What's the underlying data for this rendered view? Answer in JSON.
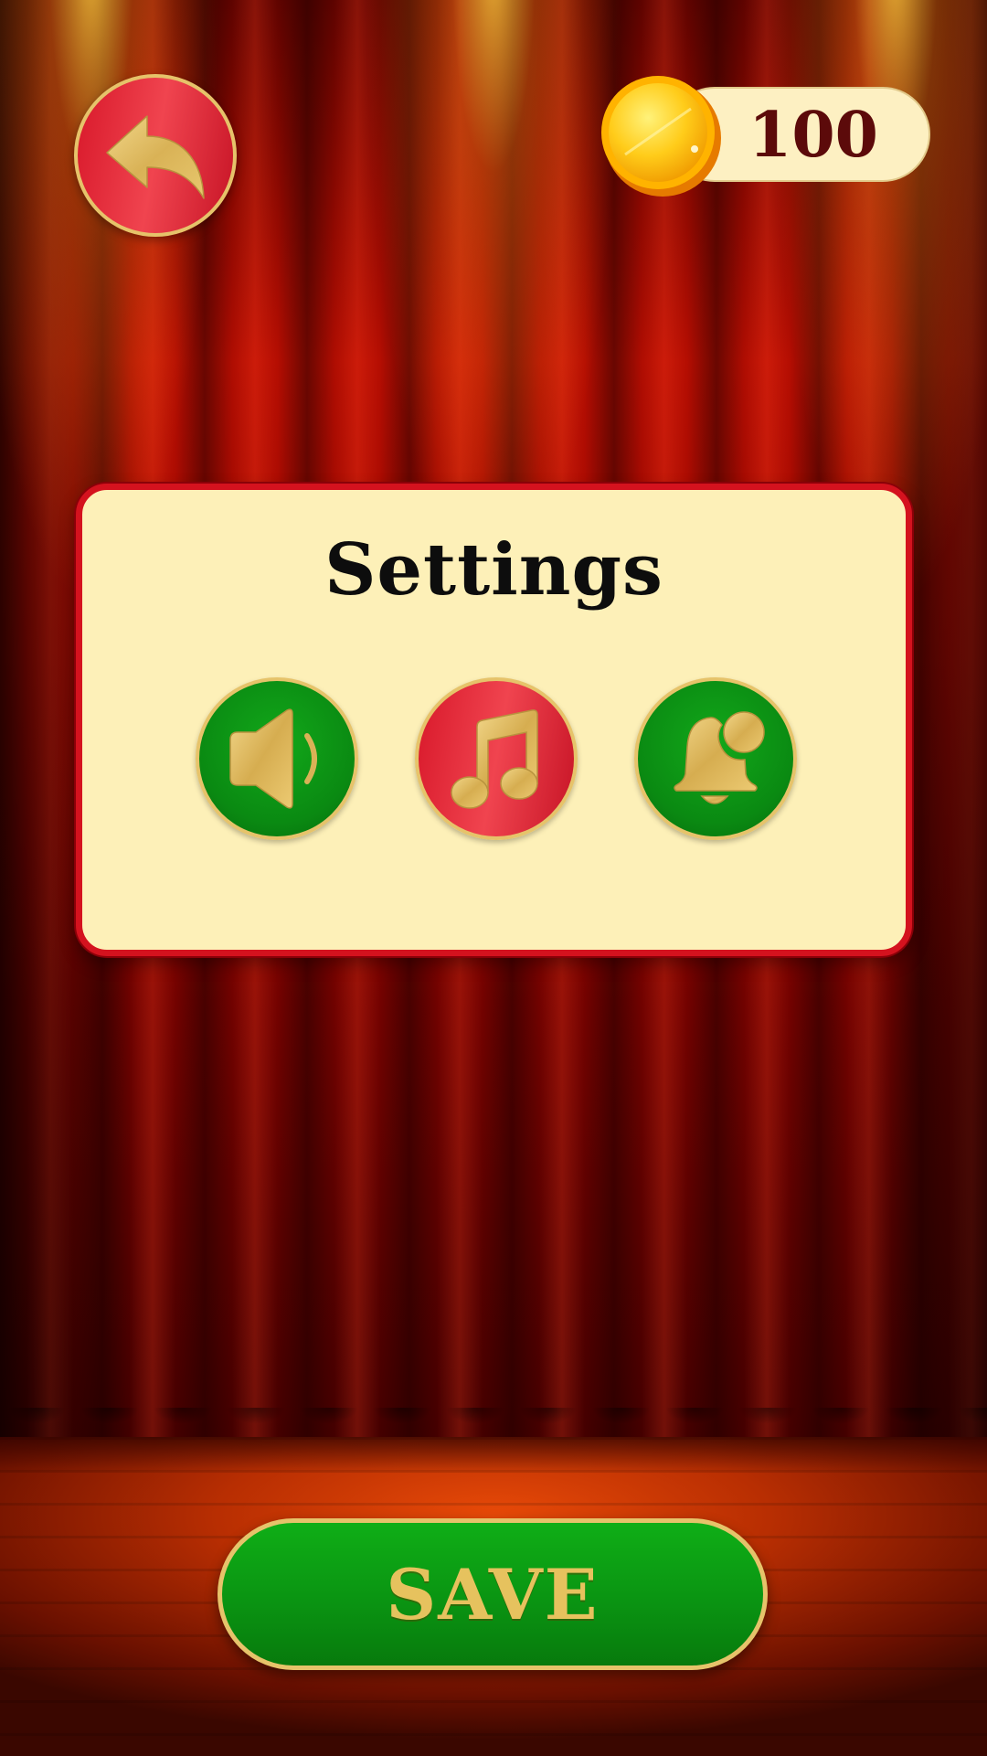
{
  "header": {
    "coins": "100"
  },
  "panel": {
    "title": "Settings",
    "options": [
      {
        "id": "sound",
        "icon": "speaker-icon",
        "state": "on",
        "color": "#0a9412"
      },
      {
        "id": "music",
        "icon": "music-note-icon",
        "state": "off",
        "color": "#e52a3a"
      },
      {
        "id": "notifications",
        "icon": "bell-icon",
        "state": "on",
        "color": "#0a9412"
      }
    ]
  },
  "footer": {
    "save_label": "SAVE"
  },
  "colors": {
    "gold": "#e6c36a",
    "panel_bg": "#fdf0b8",
    "panel_border": "#d4121e",
    "green": "#0a9412",
    "red": "#e52a3a",
    "coin_text": "#5c0a0a"
  }
}
